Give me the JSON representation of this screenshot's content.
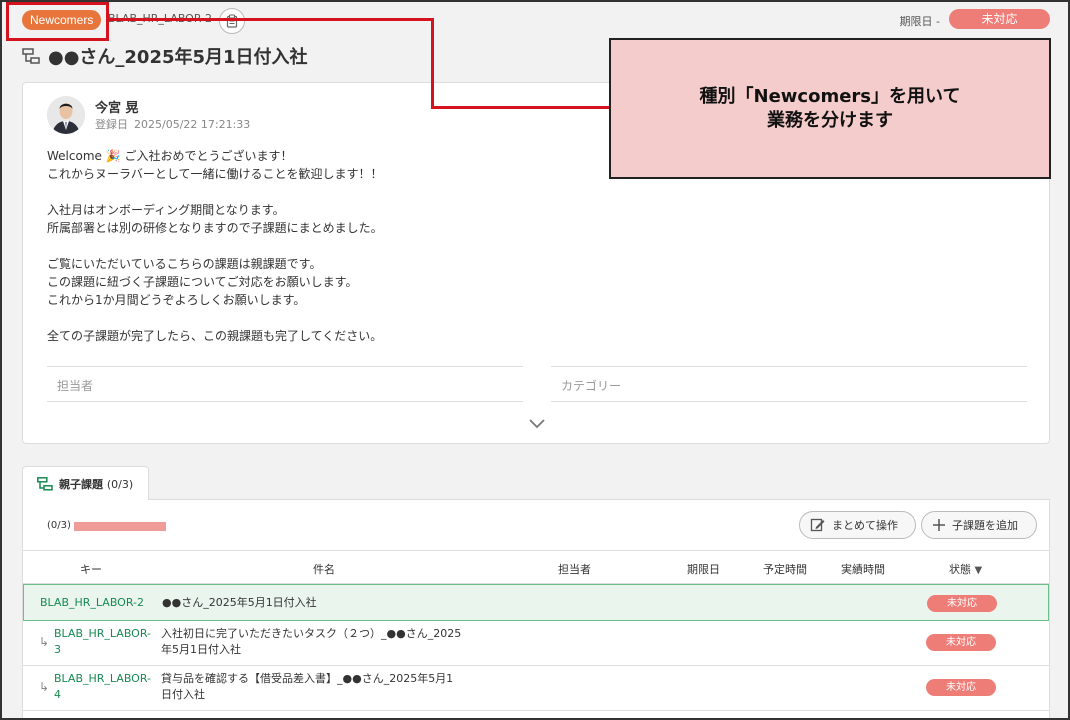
{
  "header": {
    "type_badge": "Newcomers",
    "issue_key": "BLAB_HR_LABOR-2",
    "due_label": "期限日 -",
    "status": "未対応",
    "title": "●●さん_2025年5月1日付入社"
  },
  "callout": {
    "line1": "種別「Newcomers」を用いて",
    "line2": "業務を分けます"
  },
  "description": {
    "author": "今宮 晃",
    "reg_label": "登録日",
    "reg_date": "2025/05/22 17:21:33",
    "lines": [
      "Welcome 🎉 ご入社おめでとうございます！",
      "これからヌーラバーとして一緒に働けることを歓迎します！！",
      "",
      "入社月はオンボーディング期間となります。",
      "所属部署とは別の研修となりますので子課題にまとめました。",
      "",
      "ご覧にいただいているこちらの課題は親課題です。",
      "この課題に紐づく子課題についてご対応をお願いします。",
      "これから1か月間どうぞよろしくお願いします。",
      "",
      "全ての子課題が完了したら、この親課題も完了してください。"
    ],
    "assignee_label": "担当者",
    "category_label": "カテゴリー"
  },
  "subtasks": {
    "tab_label": "親子課題",
    "tab_count": "(0/3)",
    "progress_text": "(0/3)",
    "progress_fraction": 0,
    "bulk_button": "まとめて操作",
    "add_button": "子課題を追加",
    "columns": {
      "key": "キー",
      "summary": "件名",
      "assignee": "担当者",
      "due": "期限日",
      "estimated": "予定時間",
      "actual": "実績時間",
      "status": "状態"
    },
    "rows": [
      {
        "key": "BLAB_HR_LABOR-2",
        "summary": "●●さん_2025年5月1日付入社",
        "status": "未対応"
      },
      {
        "key_a": "BLAB_HR_LABOR-",
        "key_b": "3",
        "summary_a": "入社初日に完了いただきたいタスク（２つ）_●●さん_2025",
        "summary_b": "年5月1日付入社",
        "status": "未対応"
      },
      {
        "key_a": "BLAB_HR_LABOR-",
        "key_b": "4",
        "summary_a": "貸与品を確認する【借受品差入書】_●●さん_2025年5月1",
        "summary_b": "日付入社",
        "status": "未対応"
      }
    ]
  }
}
